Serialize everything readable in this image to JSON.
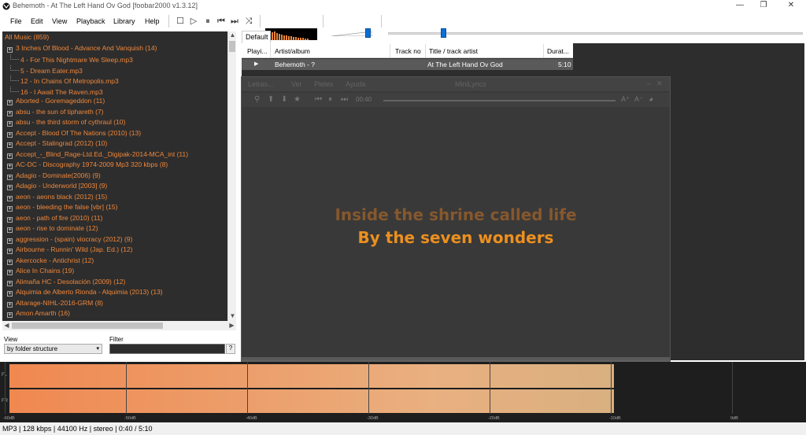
{
  "window": {
    "title": "Behemoth - At The Left Hand Ov God  [foobar2000 v1.3.12]",
    "controls": [
      "—",
      "❐",
      "✕"
    ]
  },
  "menu": [
    "File",
    "Edit",
    "View",
    "Playback",
    "Library",
    "Help"
  ],
  "toolbar": {
    "icons": [
      "stop-icon",
      "play-icon",
      "pause-icon",
      "previous-icon",
      "next-icon",
      "random-icon"
    ],
    "glyphs": [
      "☐",
      "▷",
      "⏸",
      "⏮",
      "⏭",
      "⤨"
    ],
    "volume_level": 0.9,
    "seek_position": 0.133
  },
  "library": {
    "root": "All Music (859)",
    "items": [
      {
        "text": "3 Inches Of Blood - Advance And Vanquish (14)",
        "type": "folder"
      },
      {
        "text": "4 - For This Nightmare We Sleep.mp3",
        "type": "file"
      },
      {
        "text": "5 - Dream Eater.mp3",
        "type": "file"
      },
      {
        "text": "12 - In Chains Of Metropolis.mp3",
        "type": "file"
      },
      {
        "text": "16 - I Await The Raven.mp3",
        "type": "file"
      },
      {
        "text": "Aborted - Goremageddon (11)",
        "type": "folder"
      },
      {
        "text": "absu - the sun of tiphareth (7)",
        "type": "folder"
      },
      {
        "text": "absu - the third storm of cythraul (10)",
        "type": "folder"
      },
      {
        "text": "Accept - Blood Of The Nations (2010) (13)",
        "type": "folder"
      },
      {
        "text": "Accept - Stalingrad (2012) (10)",
        "type": "folder"
      },
      {
        "text": "Accept_-_Blind_Rage-Ltd.Ed._Digipak-2014-MCA_int (11)",
        "type": "folder"
      },
      {
        "text": "AC-DC - Discography 1974-2009 Mp3 320 kbps (8)",
        "type": "folder"
      },
      {
        "text": "Adagio - Dominate(2006) (9)",
        "type": "folder"
      },
      {
        "text": "Adagio - Underworld [2003] (9)",
        "type": "folder"
      },
      {
        "text": "aeon - aeons black (2012) (15)",
        "type": "folder"
      },
      {
        "text": "aeon - bleeding the false [vbr] (15)",
        "type": "folder"
      },
      {
        "text": "aeon - path of fire (2010) (11)",
        "type": "folder"
      },
      {
        "text": "aeon - rise to dominate (12)",
        "type": "folder"
      },
      {
        "text": "aggression - (spain) viocracy (2012) (9)",
        "type": "folder"
      },
      {
        "text": "Airbourne - Runnin' Wild (Jap. Ed.) (12)",
        "type": "folder"
      },
      {
        "text": "Akercocke - Antichrist (12)",
        "type": "folder"
      },
      {
        "text": "Alice In Chains (19)",
        "type": "folder"
      },
      {
        "text": "Alimaña HC - Desolación (2009) (12)",
        "type": "folder"
      },
      {
        "text": "Alquimia de Alberto Rionda - Alquimia (2013) (13)",
        "type": "folder"
      },
      {
        "text": "Altarage-NIHL-2016-GRM (8)",
        "type": "folder"
      },
      {
        "text": "Amon Amarth (16)",
        "type": "folder"
      }
    ],
    "view_label": "View",
    "view_value": "by folder structure",
    "filter_label": "Filter",
    "filter_help": "?"
  },
  "playlist": {
    "tab": "Default",
    "columns": [
      "Playi...",
      "Artist/album",
      "Track no",
      "Title / track artist",
      "Durat..."
    ],
    "rows": [
      {
        "playing": "▶",
        "artist": "Behemoth - ?",
        "track": "",
        "title": "At The Left Hand Ov God",
        "duration": "5:10"
      }
    ]
  },
  "minilyrics": {
    "menus": [
      "Letras...",
      "Ver",
      "Pieles",
      "Ayuda"
    ],
    "title": "MiniLyrics",
    "time": "00:40",
    "lyric_prev": "Inside the shrine called life",
    "lyric_current": "By the seven wonders"
  },
  "vu": {
    "channels": [
      "FL",
      "FR"
    ],
    "levels": [
      0.77,
      0.77
    ],
    "ticks": [
      "-60dB",
      "-50dB",
      "-40dB",
      "-30dB",
      "-20dB",
      "-10dB",
      "0dB"
    ]
  },
  "status": "MP3 | 128 kbps | 44100 Hz | stereo | 0:40 / 5:10"
}
